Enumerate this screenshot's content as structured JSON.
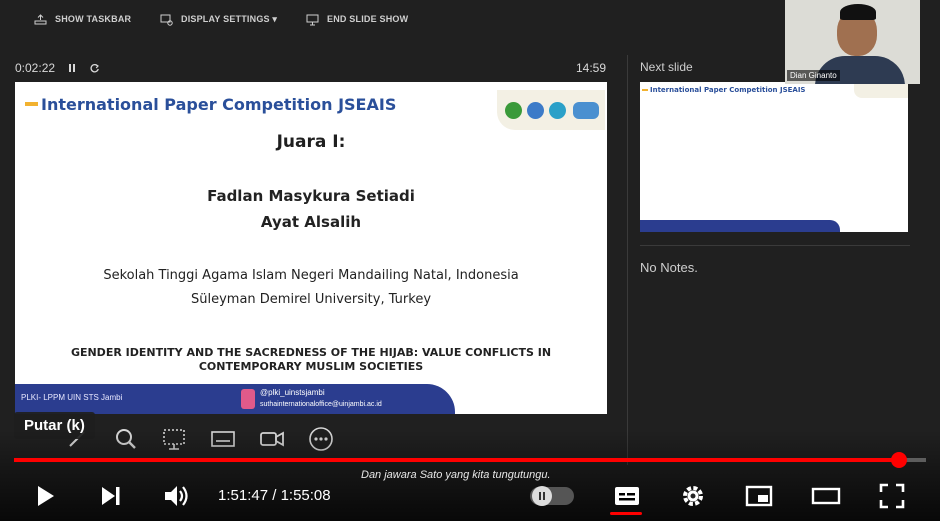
{
  "toolbar": {
    "show_taskbar": "SHOW TASKBAR",
    "display_settings": "DISPLAY SETTINGS ▾",
    "end_slide_show": "END SLIDE SHOW"
  },
  "presenter": {
    "elapsed": "0:02:22",
    "clock": "14:59",
    "next_slide_label": "Next slide",
    "notes": "No Notes."
  },
  "slide": {
    "title": "International Paper Competition JSEAIS",
    "juara": "Juara I:",
    "winners": [
      "Fadlan Masykura Setiadi",
      "Ayat Alsalih"
    ],
    "institutions": [
      "Sekolah Tinggi Agama Islam Negeri Mandailing Natal, Indonesia",
      "Süleyman Demirel University, Turkey"
    ],
    "paper_title": "GENDER IDENTITY AND THE SACREDNESS OF THE HIJAB: VALUE CONFLICTS IN CONTEMPORARY MUSLIM SOCIETIES",
    "footer_left": "PLKI- LPPM UIN STS Jambi",
    "footer_ig": "@plki_uinstsjambi",
    "footer_mail": "suthainternationaloffice@uinjambi.ac.id"
  },
  "next_slide": {
    "title": "International Paper Competition JSEAIS"
  },
  "webcam": {
    "name": "Dian Ginanto"
  },
  "player": {
    "tooltip": "Putar (k)",
    "caption": "Dan jawara Sato yang kita tungutungu.",
    "current_time": "1:51:47",
    "duration": "1:55:08",
    "time_separator": " / ",
    "progress": 0.97
  },
  "colors": {
    "accent": "#ff0000",
    "slide_title": "#2a4f9a",
    "footer_band": "#2b3d8f"
  }
}
